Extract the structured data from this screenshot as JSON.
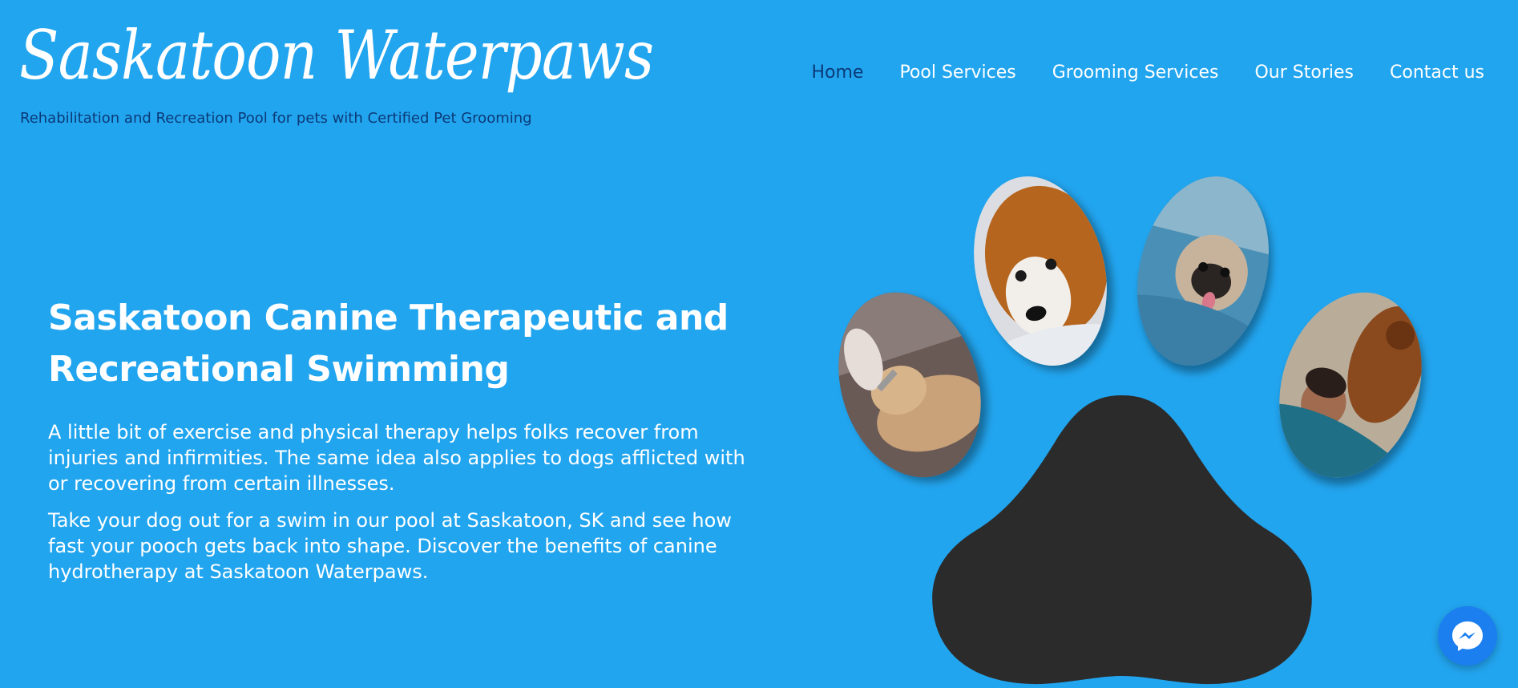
{
  "header": {
    "logo_text": "Saskatoon Waterpaws",
    "tagline": "Rehabilitation and Recreation Pool for pets with Certified Pet Grooming"
  },
  "nav": {
    "items": [
      {
        "label": "Home",
        "active": true
      },
      {
        "label": "Pool Services",
        "active": false
      },
      {
        "label": "Grooming Services",
        "active": false
      },
      {
        "label": "Our Stories",
        "active": false
      },
      {
        "label": "Contact us",
        "active": false
      }
    ]
  },
  "hero": {
    "title": "Saskatoon Canine Therapeutic and Recreational Swimming",
    "paragraph1": "A little bit of exercise and physical therapy helps folks recover from injuries and infirmities. The same idea also applies to dogs afflicted with or recovering from certain illnesses.",
    "paragraph2": "Take your dog out for a swim in our pool at Saskatoon, SK and see how fast your pooch gets back into shape. Discover the benefits of canine hydrotherapy at Saskatoon Waterpaws."
  },
  "colors": {
    "background": "#22a5ef",
    "nav_active": "#0b3a78",
    "tagline": "#0b3a78",
    "paw_pad": "#2b2b2b",
    "messenger": "#1b7ff0"
  },
  "icons": {
    "chat": "messenger-icon",
    "paw": "paw-print-graphic"
  }
}
